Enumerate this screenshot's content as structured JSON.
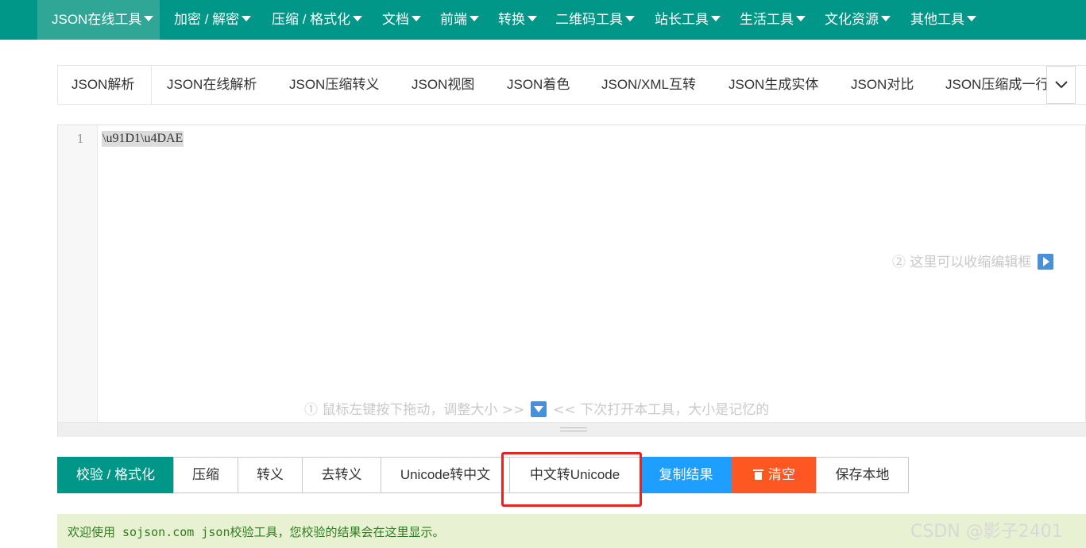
{
  "navbar": {
    "items": [
      {
        "label": "JSON在线工具"
      },
      {
        "label": "加密 / 解密"
      },
      {
        "label": "压缩 / 格式化"
      },
      {
        "label": "文档"
      },
      {
        "label": "前端"
      },
      {
        "label": "转换"
      },
      {
        "label": "二维码工具"
      },
      {
        "label": "站长工具"
      },
      {
        "label": "生活工具"
      },
      {
        "label": "文化资源"
      },
      {
        "label": "其他工具"
      }
    ],
    "bg_color": "#009688"
  },
  "tabs": {
    "items": [
      {
        "label": "JSON解析"
      },
      {
        "label": "JSON在线解析"
      },
      {
        "label": "JSON压缩转义"
      },
      {
        "label": "JSON视图"
      },
      {
        "label": "JSON着色"
      },
      {
        "label": "JSON/XML互转"
      },
      {
        "label": "JSON生成实体"
      },
      {
        "label": "JSON对比"
      },
      {
        "label": "JSON压缩成一行"
      }
    ],
    "active_index": 0,
    "more_icon": "chevron-down-icon"
  },
  "editor": {
    "line_number": "1",
    "content": "\\u91D1\\u4DAE",
    "hint_collapse": "② 这里可以收缩编辑框",
    "hint_resize_left": "① 鼠标左键按下拖动，调整大小 >>",
    "hint_resize_right": "<< 下次打开本工具，大小是记忆的"
  },
  "buttons": {
    "validate": "校验 / 格式化",
    "compress": "压缩",
    "escape": "转义",
    "unescape": "去转义",
    "unicode_to_cn": "Unicode转中文",
    "cn_to_unicode": "中文转Unicode",
    "copy_result": "复制结果",
    "clear": "清空",
    "save_local": "保存本地"
  },
  "colors": {
    "primary": "#009688",
    "blue": "#1e9fff",
    "danger": "#ff5722",
    "highlight": "#e5251f"
  },
  "result": {
    "message": "欢迎使用 sojson.com json校验工具，您校验的结果会在这里显示。"
  },
  "watermark": "CSDN @影子2401"
}
